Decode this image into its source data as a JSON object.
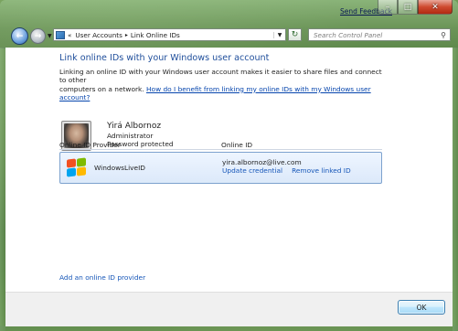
{
  "window": {
    "feedback_label": "Send Feedback"
  },
  "address_bar": {
    "overflow": "«",
    "crumbs": [
      "User Accounts",
      "Link Online IDs"
    ],
    "separator": "▸"
  },
  "search": {
    "placeholder": "Search Control Panel"
  },
  "main": {
    "title": "Link online IDs with your Windows user account",
    "intro_line1": "Linking an online ID with your Windows user account makes it easier to share files and connect to other",
    "intro_line2_prefix": "computers on a network. ",
    "intro_link": "How do I benefit from linking my online IDs with my Windows user account?",
    "user": {
      "name": "Yirá Albornoz",
      "role": "Administrator",
      "security": "Password protected"
    },
    "columns": {
      "provider": "Online ID Provider",
      "online_id": "Online ID"
    },
    "providers": [
      {
        "name": "WindowsLiveID",
        "online_id": "yira.albornoz@live.com",
        "update_label": "Update credential",
        "remove_label": "Remove linked ID"
      }
    ],
    "add_provider_label": "Add an online ID provider"
  },
  "footer": {
    "ok_label": "OK"
  },
  "icons": {
    "back": "back-arrow-icon",
    "forward": "forward-arrow-icon",
    "control_panel": "control-panel-icon",
    "refresh": "refresh-icon",
    "search": "search-icon",
    "minimize": "minimize-icon",
    "maximize": "maximize-icon",
    "close": "close-icon",
    "provider_logo": "windows-logo-icon"
  },
  "colors": {
    "title": "#1f4e9b",
    "link": "#1656b8",
    "selection": "#dce9fa",
    "close_button": "#cf4b30"
  }
}
